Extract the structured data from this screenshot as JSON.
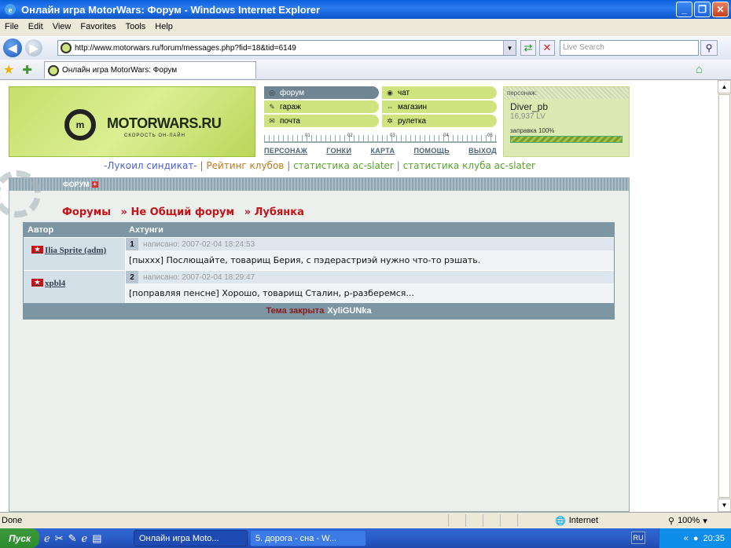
{
  "window": {
    "title": "Онлайн игра MotorWars: Форум - Windows Internet Explorer"
  },
  "menubar": [
    "File",
    "Edit",
    "View",
    "Favorites",
    "Tools",
    "Help"
  ],
  "address": {
    "url": "http://www.motorwars.ru/forum/messages.php?fid=18&tid=6149",
    "search_placeholder": "Live Search"
  },
  "tab": {
    "title": "Онлайн игра MotorWars: Форум"
  },
  "site": {
    "logo_text": "MOTORWARS.RU",
    "logo_sub": "СКОРОСТЬ ОН-ЛАЙН",
    "menu": [
      {
        "label": "форум",
        "icon": "forum-icon"
      },
      {
        "label": "чат",
        "icon": "chat-icon"
      },
      {
        "label": "гараж",
        "icon": "wrench-icon"
      },
      {
        "label": "магазин",
        "icon": "car-icon"
      },
      {
        "label": "почта",
        "icon": "mail-icon"
      },
      {
        "label": "рулетка",
        "icon": "roulette-icon"
      }
    ],
    "ruler_marks": [
      "01",
      "02",
      "03",
      "04",
      "05"
    ],
    "links": [
      "ПЕРСОНАЖ",
      "ГОНКИ",
      "КАРТА",
      "ПОМОЩЬ",
      "ВЫХОД"
    ],
    "status": {
      "label": "персонаж:",
      "nick": "Diver_pb",
      "lv": "16,937 LV",
      "fuel": "заправка 100%",
      "fuel_value": 1.0
    },
    "syndicate_links": {
      "lukoil": "-Лукоил синдикат-",
      "rating": "Рейтинг клубов",
      "stats": "статистика ac-slater",
      "club_stats": "статистика клуба ac-slater",
      "sep": "|"
    }
  },
  "forum": {
    "header": "ФОРУМ",
    "breadcrumbs": [
      "Форумы",
      "» Не Общий форум",
      "» Лубянка"
    ],
    "columns": [
      "Автор",
      "Ахтунги"
    ],
    "posts": [
      {
        "author": "Ilia Sprite (adm)",
        "num": "1",
        "date": "написано: 2007-02-04 18:24:53",
        "text": "[пыхxx] Послющайте, товарищ Берия, с пэдерастриэй нужно что-то рэшать."
      },
      {
        "author": "xpbl4",
        "num": "2",
        "date": "написано: 2007-02-04 18:29:47",
        "text": "[поправляя пенсне] Хорошо, товарищ Сталин, р-разберемся..."
      }
    ],
    "footer_closed": "Тема закрыта",
    "footer_by": "XyliGUNka"
  },
  "statusbar": {
    "text": "Done",
    "zone": "Internet",
    "zoom": "100%"
  },
  "taskbar": {
    "start": "Пуск",
    "tasks": [
      "Онлайн игра Moto...",
      "5. дорога - сна - W..."
    ],
    "lang": "RU",
    "time": "20:35"
  }
}
